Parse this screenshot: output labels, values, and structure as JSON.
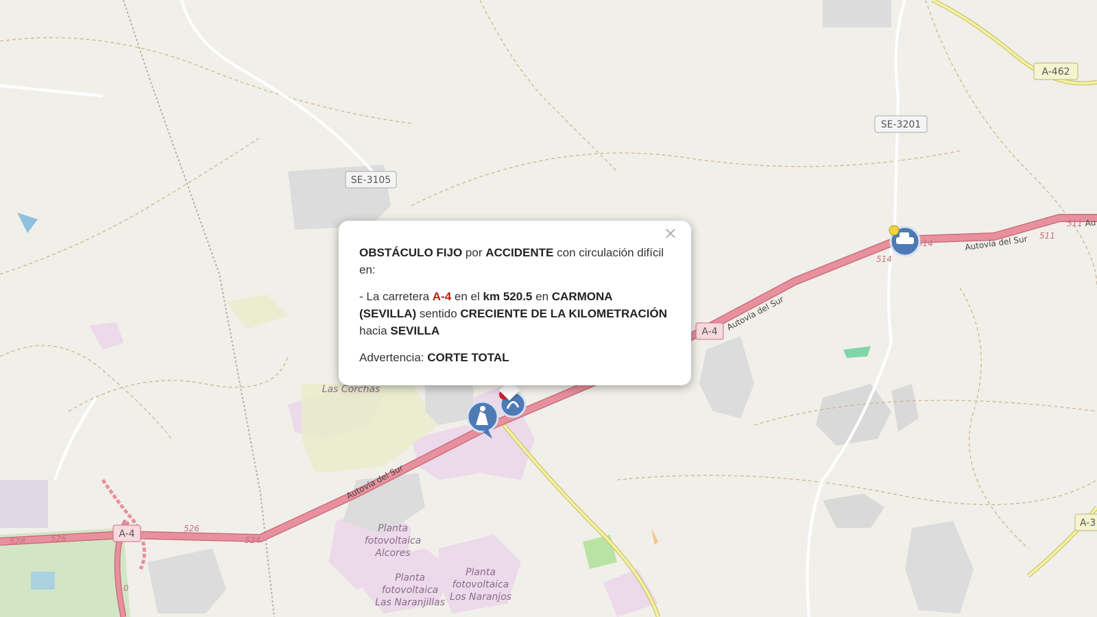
{
  "map": {
    "road_shields": [
      "SE-3105",
      "SE-3201",
      "A-462",
      "A-4",
      "A-4",
      "A-3"
    ],
    "road_names": [
      "Autovía del Sur",
      "Autovía del Sur",
      "Autovía del Sur",
      "Au"
    ],
    "km_markers": [
      "514",
      "514",
      "511",
      "511",
      "526",
      "524",
      "528",
      "526",
      "0"
    ],
    "place_labels": {
      "las_corchas": "Las Corchas",
      "planta_alcores": [
        "Planta",
        "fotovoltaica",
        "Alcores"
      ],
      "planta_naranjillas": [
        "Planta",
        "fotovoltaica",
        "Las Naranjillas"
      ],
      "planta_naranjos": [
        "Planta",
        "fotovoltaica",
        "Los Naranjos"
      ]
    },
    "icons": [
      "roadwork-icon",
      "accident-icon",
      "accident-icon",
      "warning-dot-icon"
    ],
    "colors": {
      "land": "#f1efe9",
      "motorway": "#e8909d",
      "secondary": "#f2f0a6",
      "popup_highlight": "#b5230f"
    }
  },
  "popup": {
    "close": "×",
    "line1": {
      "obstacle": "OBSTÁCULO FIJO",
      "por": "por",
      "cause": "ACCIDENTE",
      "rest": "con circulación difícil en:"
    },
    "line2": {
      "prefix": "- La carretera",
      "road": "A-4",
      "en_el": "en el",
      "km": "km 520.5",
      "en": "en",
      "place": "CARMONA (SEVILLA)",
      "sentido": "sentido",
      "direction": "CRECIENTE DE LA KILOMETRACIÓN",
      "hacia": "hacia",
      "dest": "SEVILLA"
    },
    "line3": {
      "label": "Advertencia:",
      "value": "CORTE TOTAL"
    }
  }
}
